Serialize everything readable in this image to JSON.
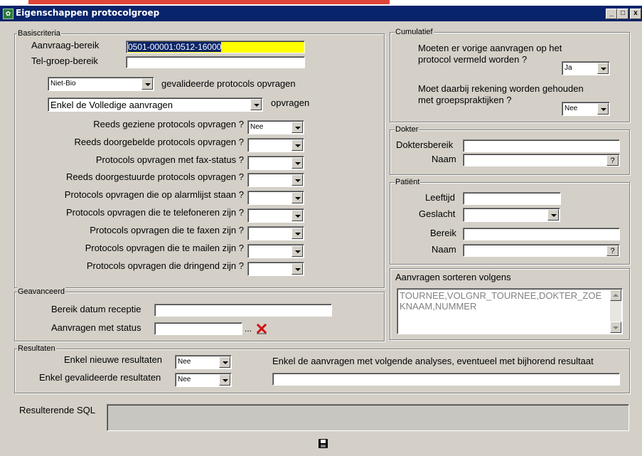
{
  "window": {
    "title": "Eigenschappen protocolgroep",
    "min": "_",
    "max": "□",
    "close": "x",
    "accent": "#e0453a",
    "titlebar_color": "#08246b"
  },
  "basis": {
    "legend": "Basiscriteria",
    "aanvraag_label": "Aanvraag-bereik",
    "aanvraag_value": "0501-00001:0512-16000",
    "telgroep_label": "Tel-groep-bereik",
    "telgroep_value": "",
    "bio_value": "Niet-Bio",
    "bio_suffix": "gevalideerde protocols opvragen",
    "volledig_value": "Enkel de Volledige aanvragen",
    "volledig_suffix": "opvragen",
    "rows": [
      {
        "label": "Reeds geziene protocols opvragen ?",
        "value": "Nee"
      },
      {
        "label": "Reeds doorgebelde protocols opvragen ?",
        "value": ""
      },
      {
        "label": "Protocols opvragen met fax-status ?",
        "value": ""
      },
      {
        "label": "Reeds doorgestuurde protocols opvragen ?",
        "value": ""
      },
      {
        "label": "Protocols opvragen die op alarmlijst staan ?",
        "value": ""
      },
      {
        "label": "Protocols opvragen die te telefoneren zijn ?",
        "value": ""
      },
      {
        "label": "Protocols opvragen die te faxen zijn ?",
        "value": ""
      },
      {
        "label": "Protocols opvragen die te mailen zijn ?",
        "value": ""
      },
      {
        "label": "Protocols opvragen die dringend zijn ?",
        "value": ""
      }
    ]
  },
  "cumulatief": {
    "legend": "Cumulatief",
    "q1_line1": "Moeten er vorige aanvragen op het",
    "q1_line2": "protocol vermeld worden ?",
    "q1_value": "Ja",
    "q2_line1": "Moet daarbij rekening worden gehouden",
    "q2_line2": "met groepspraktijken ?",
    "q2_value": "Nee"
  },
  "dokter": {
    "legend": "Dokter",
    "bereik_label": "Doktersbereik",
    "bereik_value": "",
    "naam_label": "Naam",
    "naam_value": "",
    "lookup": "?"
  },
  "patient": {
    "legend": "Patiënt",
    "leeftijd_label": "Leeftijd",
    "geslacht_label": "Geslacht",
    "geslacht_value": "",
    "bereik_label": "Bereik",
    "naam_label": "Naam",
    "lookup": "?"
  },
  "sorteren": {
    "title": "Aanvragen sorteren volgens",
    "value": "TOURNEE,VOLGNR_TOURNEE,DOKTER_ZOEKNAAM,NUMMER"
  },
  "geavanceerd": {
    "legend": "Geavanceerd",
    "datum_label": "Bereik datum receptie",
    "datum_value": "",
    "status_label": "Aanvragen met status",
    "status_value": "",
    "browse": "...",
    "clear_icon": "red-x-icon"
  },
  "resultaten": {
    "legend": "Resultaten",
    "nieuw_label": "Enkel nieuwe resultaten",
    "nieuw_value": "Nee",
    "gevalideerd_label": "Enkel gevalideerde resultaten",
    "gevalideerd_value": "Nee",
    "analyses_label": "Enkel de aanvragen met volgende analyses, eventueel met bijhorend resultaat",
    "analyses_value": ""
  },
  "sql": {
    "label": "Resulterende SQL",
    "value": ""
  },
  "save": {
    "icon": "floppy-disk-icon"
  }
}
